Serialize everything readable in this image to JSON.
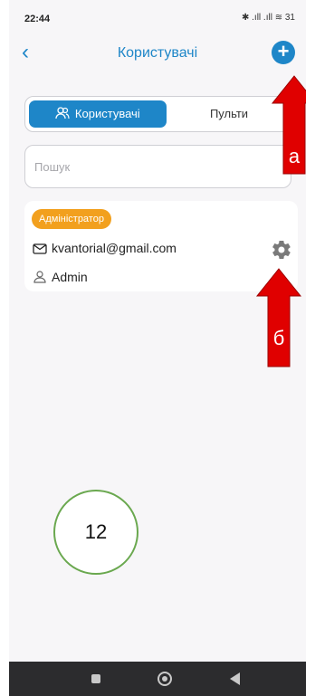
{
  "status": {
    "time": "22:44",
    "icons": "✱ .ıll .ıll ≋ 31"
  },
  "header": {
    "title": "Користувачі",
    "back_icon": "chevron-left-icon",
    "add_icon": "plus-icon"
  },
  "tabs": {
    "users_label": "Користувачі",
    "remotes_label": "Пульти"
  },
  "search": {
    "placeholder": "Пошук"
  },
  "user_card": {
    "role": "Адміністратор",
    "email": "kvantorial@gmail.com",
    "name": "Admin"
  },
  "annotations": {
    "arrow_a": "а",
    "arrow_b": "б",
    "circle_number": "12"
  },
  "colors": {
    "accent": "#1e86c8",
    "badge": "#f2a01e",
    "annotation_arrow": "#e00000",
    "circle": "#6aa84f"
  }
}
